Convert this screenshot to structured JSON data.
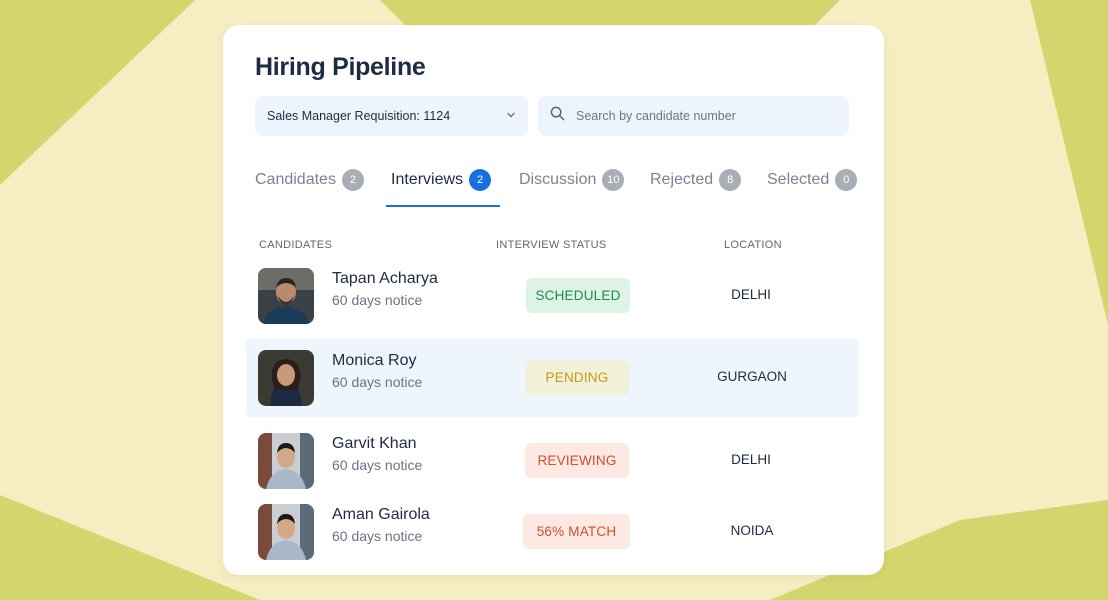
{
  "page": {
    "title": "Hiring Pipeline"
  },
  "filter": {
    "requisition_label": "Sales Manager Requisition: 1124"
  },
  "search": {
    "placeholder": "Search by candidate number",
    "value": ""
  },
  "tabs": [
    {
      "label": "Candidates",
      "count": "2",
      "active": false
    },
    {
      "label": "Interviews",
      "count": "2",
      "active": true
    },
    {
      "label": "Discussion",
      "count": "10",
      "active": false
    },
    {
      "label": "Rejected",
      "count": "8",
      "active": false
    },
    {
      "label": "Selected",
      "count": "0",
      "active": false
    }
  ],
  "table": {
    "headers": [
      "CANDIDATES",
      "INTERVIEW STATUS",
      "LOCATION"
    ],
    "rows": [
      {
        "name": "Tapan Acharya",
        "notice": "60 days notice",
        "status": "SCHEDULED",
        "location": "DELHI",
        "highlighted": false
      },
      {
        "name": "Monica Roy",
        "notice": "60 days notice",
        "status": "PENDING",
        "location": "GURGAON",
        "highlighted": true
      },
      {
        "name": "Garvit Khan",
        "notice": "60 days notice",
        "status": "REVIEWING",
        "location": "DELHI",
        "highlighted": false
      },
      {
        "name": "Aman Gairola",
        "notice": "60 days notice",
        "status": "56% MATCH",
        "location": "NOIDA",
        "highlighted": false
      }
    ]
  },
  "colors": {
    "accent": "#1a6fe0",
    "background": "#f7edc3",
    "background_shape": "#d5d56e",
    "scheduled_bg": "#dcf3e6",
    "scheduled_fg": "#1f8a4c",
    "pending_bg": "#f2f0d8",
    "pending_fg": "#c79a1a",
    "reviewing_bg": "#fde8e2",
    "reviewing_fg": "#d0502c",
    "match_bg": "#fde8e2",
    "match_fg": "#d0502c"
  },
  "icons": {
    "dropdown": "chevron-down-icon",
    "search": "search-icon"
  }
}
